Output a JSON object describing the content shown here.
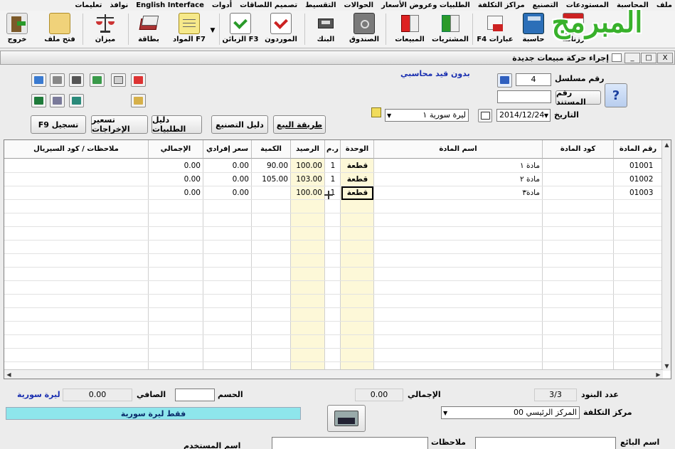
{
  "menu": [
    "ملف",
    "المحاسبة",
    "المستودعات",
    "التصنيع",
    "مراكز التكلفة",
    "الطلبيات وعروض الأسعار",
    "الحوالات",
    "التقسيط",
    "تصميم اللصاقات",
    "أدوات",
    "English Interface",
    "نوافذ",
    "تعليمات"
  ],
  "logo_text": "المبرمج",
  "toolbar": {
    "exit": "خروج",
    "open_file": "فتح ملف",
    "balance": "ميزان",
    "card": "بطاقة",
    "materials": "المواد F7",
    "customers": "الزبائن F3",
    "suppliers": "الموردون",
    "bank": "البنك",
    "cashbox": "الصندوق",
    "sales": "المبيعات",
    "purchases": "المشتريات",
    "phrases": "F4 عبارات",
    "calculator": "حاسبة",
    "calendar": "رزنامة"
  },
  "window": {
    "title": "إجراء حركة مبيعات جديدة",
    "minimize": "_",
    "restore": "□",
    "close": "X"
  },
  "header": {
    "no_accounting": "بدون قيد محاسبي",
    "serial_label": "رقم مسلسل",
    "serial_value": "4",
    "doc_number_button": "رقم المستند",
    "doc_number_value": "",
    "date_label": "التاريخ",
    "date_value": "2014/12/24",
    "currency_value": "ليرة سورية ١",
    "help": "?"
  },
  "buttons": {
    "sale_method": "طريقة البيع",
    "manufacture_guide": "دليل التصنيع",
    "orders_guide": "دليل الطلبيات",
    "pricing_outputs": "تسعير الإخراجات",
    "register": "F9 تسجيل"
  },
  "columns": [
    "رقم المادة",
    "كود المادة",
    "اسم المادة",
    "الوحدة",
    "ر.م",
    "الرصيد",
    "الكمية",
    "سعر إفرادي",
    "الإجمالي",
    "ملاحظات / كود السيريال"
  ],
  "rows": [
    {
      "item_no": "01001",
      "code": "",
      "name": "مادة ١",
      "unit": "قطعة",
      "rm": "1",
      "balance": "100.00",
      "qty": "90.00",
      "price": "0.00",
      "total": "0.00",
      "notes": ""
    },
    {
      "item_no": "01002",
      "code": "",
      "name": "مادة ٢",
      "unit": "قطعة",
      "rm": "1",
      "balance": "103.00",
      "qty": "105.00",
      "price": "0.00",
      "total": "0.00",
      "notes": ""
    },
    {
      "item_no": "01003",
      "code": "",
      "name": "مادة٣",
      "unit": "قطعة",
      "rm": "1",
      "balance": "100.00",
      "qty": "",
      "price": "0.00",
      "total": "0.00",
      "notes": ""
    }
  ],
  "footer": {
    "items_count_label": "عدد البنود",
    "items_count_value": "3/3",
    "total_label": "الإجمالي",
    "total_value": "0.00",
    "discount_label": "الحسم",
    "discount_value": "",
    "net_label": "الصافي",
    "net_value": "0.00",
    "currency": "ليرة سورية",
    "cost_center_label": "مركز التكلفة",
    "cost_center_value": "المركز الرئيسي 00",
    "cash_banner": "فقط ليرة سورية",
    "seller_label": "اسم البائع",
    "seller_value": "",
    "notes_label": "ملاحظات",
    "notes_value": "",
    "user_label": "اسم المستخدم"
  },
  "colors": {
    "accent_blue": "#1a2fb0",
    "banner": "#8ee6ec",
    "column_highlight": "#fdf8d8"
  }
}
